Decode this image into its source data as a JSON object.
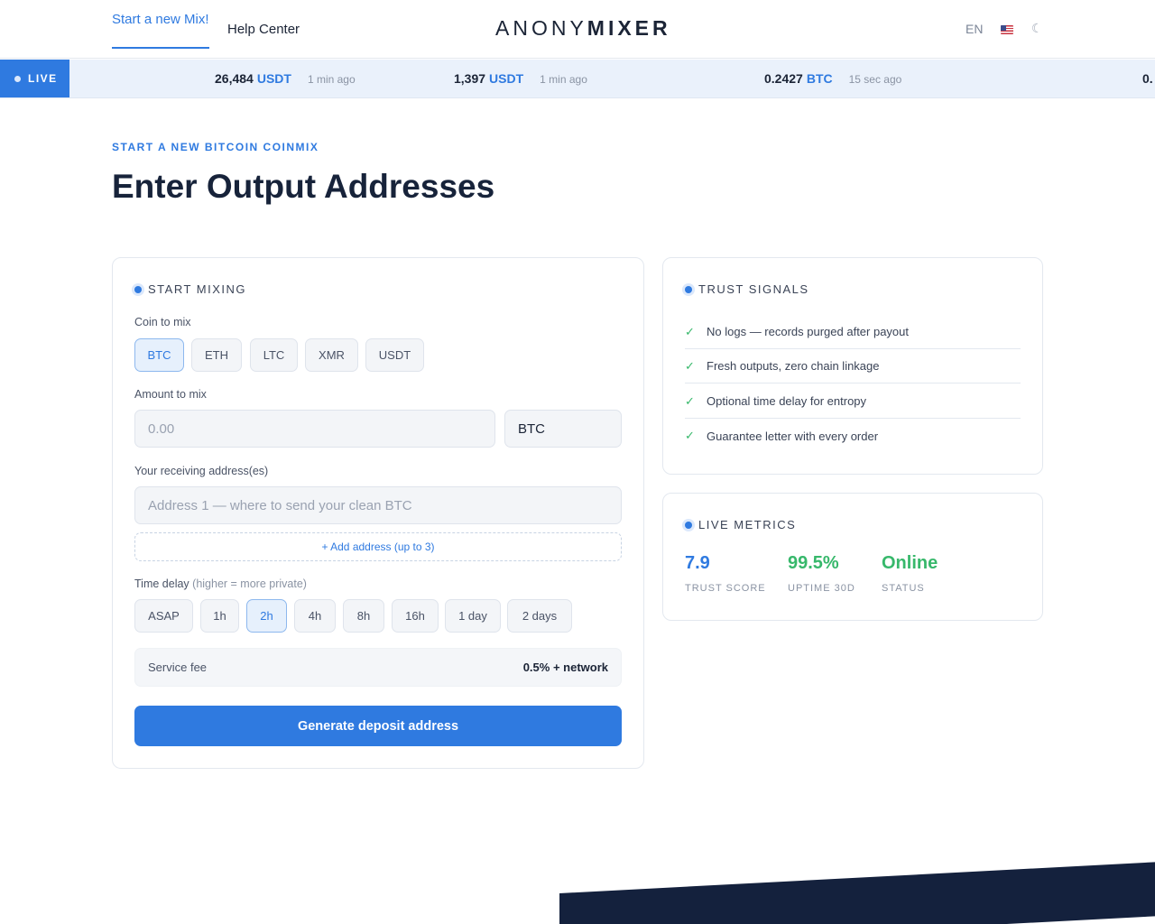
{
  "header": {
    "tabs": [
      {
        "label": "Start a new Mix!",
        "active": true
      },
      {
        "label": "Help Center",
        "active": false
      }
    ],
    "logo": {
      "light": "ANONY",
      "bold": "MIXER"
    },
    "language": "EN",
    "flag_icon": "us-flag-icon",
    "theme_icon": "moon-icon"
  },
  "ticker": {
    "badge": "LIVE",
    "items": [
      {
        "amount": "26,484",
        "coin": "USDT",
        "ago": "1 min ago"
      },
      {
        "amount": "1,397",
        "coin": "USDT",
        "ago": "1 min ago"
      },
      {
        "amount": "0.2427",
        "coin": "BTC",
        "ago": "15 sec ago"
      },
      {
        "amount": "0.",
        "coin": "",
        "ago": ""
      }
    ]
  },
  "hero": {
    "eyebrow": "START A NEW BITCOIN COINMIX",
    "title": "Enter Output Addresses"
  },
  "mixing": {
    "heading": "START MIXING",
    "coin_label": "Coin to mix",
    "coins": [
      "BTC",
      "ETH",
      "LTC",
      "XMR",
      "USDT"
    ],
    "selected_coin": "BTC",
    "amount_label": "Amount to mix",
    "amount_placeholder": "0.00",
    "amount_unit": "BTC",
    "address_label": "Your receiving address(es)",
    "address_placeholder": "Address 1 — where to send your clean BTC",
    "add_address": "+ Add address (up to 3)",
    "delay_label": "Time delay",
    "delay_hint": "(higher = more private)",
    "delays": [
      "ASAP",
      "1h",
      "2h",
      "4h",
      "8h",
      "16h",
      "1 day",
      "2 days"
    ],
    "selected_delay": "2h",
    "fee_label": "Service fee",
    "fee_value": "0.5% + network",
    "cta": "Generate deposit address"
  },
  "trust": {
    "heading": "TRUST SIGNALS",
    "items": [
      "No logs — records purged after payout",
      "Fresh outputs, zero chain linkage",
      "Optional time delay for entropy",
      "Guarantee letter with every order"
    ]
  },
  "metrics": {
    "heading": "LIVE METRICS",
    "items": [
      {
        "value": "7.9",
        "label": "TRUST SCORE",
        "color": "#2f7ae0"
      },
      {
        "value": "99.5%",
        "label": "UPTIME 30D",
        "color": "#37b86b"
      },
      {
        "value": "Online",
        "label": "STATUS",
        "color": "#37b86b"
      }
    ]
  }
}
